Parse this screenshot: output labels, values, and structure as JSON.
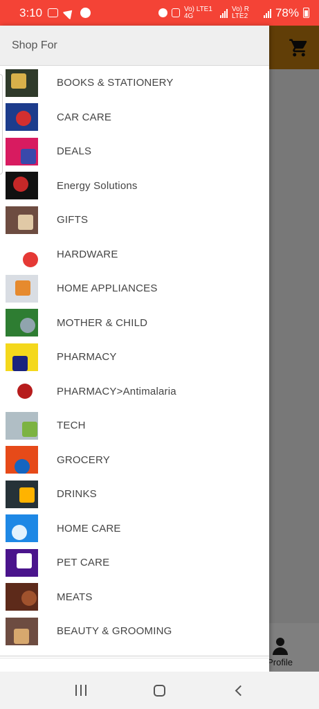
{
  "status_bar": {
    "time": "3:10",
    "network": "Vo) LTE1 4G",
    "network2": "Vo) R LTE2",
    "battery": "78%"
  },
  "drawer": {
    "title": "Shop For",
    "items": [
      {
        "label": "BOOKS & STATIONERY",
        "icon": "books-thumbnail",
        "c1": "#2f3a2a",
        "c2": "#d8b04a"
      },
      {
        "label": "CAR CARE",
        "icon": "car-care-thumbnail",
        "c1": "#1c3c8c",
        "c2": "#d32f2f"
      },
      {
        "label": "DEALS",
        "icon": "deals-thumbnail",
        "c1": "#d81b60",
        "c2": "#3949ab"
      },
      {
        "label": "Energy Solutions",
        "icon": "energy-thumbnail",
        "c1": "#111111",
        "c2": "#c62828"
      },
      {
        "label": "GIFTS",
        "icon": "gifts-thumbnail",
        "c1": "#6d4c41",
        "c2": "#e0c9a6"
      },
      {
        "label": "HARDWARE",
        "icon": "hardware-thumbnail",
        "c1": "#ffffff",
        "c2": "#e53935"
      },
      {
        "label": "HOME APPLIANCES",
        "icon": "home-appliances-thumbnail",
        "c1": "#d9dde3",
        "c2": "#e68a2e"
      },
      {
        "label": "MOTHER & CHILD",
        "icon": "mother-child-thumbnail",
        "c1": "#2e7d32",
        "c2": "#90a4ae"
      },
      {
        "label": "PHARMACY",
        "icon": "pharmacy-thumbnail",
        "c1": "#f4d81c",
        "c2": "#1a237e"
      },
      {
        "label": "PHARMACY>Antimalaria",
        "icon": "mosquito-thumbnail",
        "c1": "#ffffff",
        "c2": "#b71c1c"
      },
      {
        "label": "TECH",
        "icon": "tech-thumbnail",
        "c1": "#b0bec5",
        "c2": "#7cb342"
      },
      {
        "label": "GROCERY",
        "icon": "grocery-thumbnail",
        "c1": "#e64a19",
        "c2": "#1565c0"
      },
      {
        "label": "DRINKS",
        "icon": "drinks-thumbnail",
        "c1": "#263238",
        "c2": "#ffb300"
      },
      {
        "label": "HOME CARE",
        "icon": "home-care-thumbnail",
        "c1": "#1e88e5",
        "c2": "#e3f2fd"
      },
      {
        "label": "PET CARE",
        "icon": "pet-care-thumbnail",
        "c1": "#4a148c",
        "c2": "#ffffff"
      },
      {
        "label": "MEATS",
        "icon": "meats-thumbnail",
        "c1": "#5d2a1a",
        "c2": "#a0522d"
      },
      {
        "label": "BEAUTY & GROOMING",
        "icon": "beauty-thumbnail",
        "c1": "#6d4c41",
        "c2": "#d7a86e"
      }
    ]
  },
  "background": {
    "header_color": "#c27c0e",
    "profile_label": "Profile"
  },
  "colors": {
    "status_bar": "#f44336",
    "drawer_header_bg": "#efefef",
    "label_text": "#444444"
  }
}
